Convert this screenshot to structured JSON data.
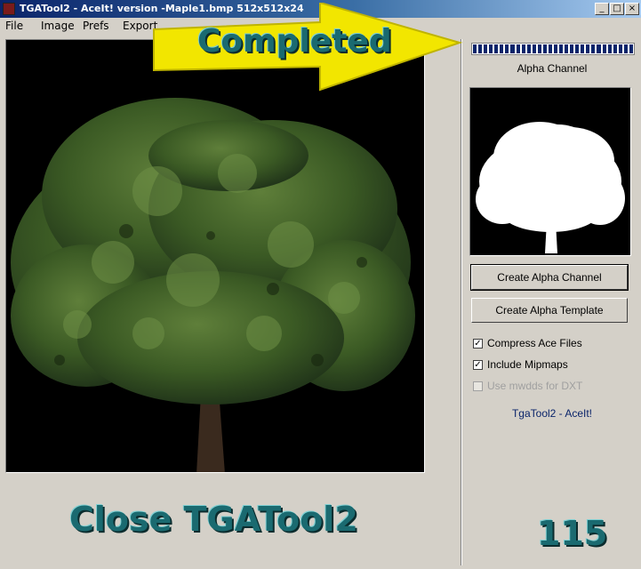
{
  "window": {
    "title": "TGATool2 - AceIt! version -Maple1.bmp  512x512x24",
    "controls": {
      "minimize": "_",
      "maximize": "□",
      "close": "×"
    }
  },
  "menu": [
    "File",
    "Image",
    "Prefs",
    "Export"
  ],
  "annotation": {
    "callout": "Completed",
    "caption": "Close TGATool2",
    "number": "115"
  },
  "progress": {
    "segments": 30,
    "fraction": 1.0,
    "color": "#0a246a"
  },
  "side": {
    "alpha_label": "Alpha Channel",
    "create_alpha_channel": "Create Alpha Channel",
    "create_alpha_template": "Create Alpha Template",
    "options": [
      {
        "label": "Compress Ace Files",
        "checked": true,
        "enabled": true
      },
      {
        "label": "Include Mipmaps",
        "checked": true,
        "enabled": true
      },
      {
        "label": "Use mwdds for DXT",
        "checked": false,
        "enabled": false
      }
    ],
    "footer": "TgaTool2 - AceIt!"
  },
  "colors": {
    "titlebar": "#0a246a",
    "window_bg": "#d4d0c8",
    "callout_yellow": "#f2e600",
    "annotation_teal": "#1a6a70"
  }
}
